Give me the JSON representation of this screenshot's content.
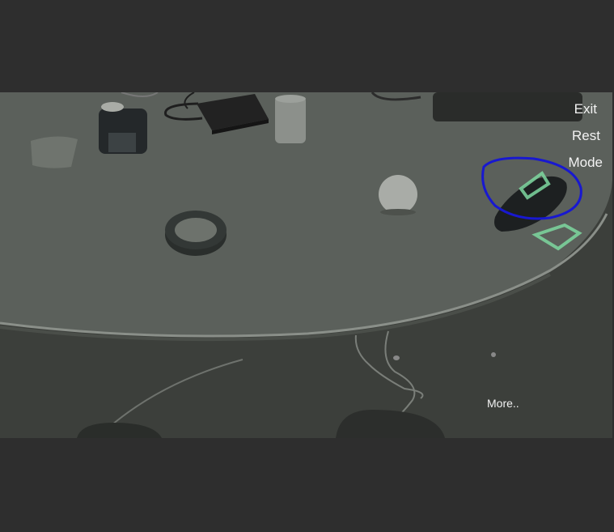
{
  "controls": {
    "exit_label": "Exit",
    "rest_label": "Rest",
    "mode_label": "Mode",
    "more_label": "More.."
  },
  "colors": {
    "background": "#2e2e2e",
    "annotation_stroke": "#1818d0",
    "detection_box": "#7ed8a0",
    "table_surface": "#5b605b",
    "floor": "#3c3f3b"
  },
  "icons": {
    "selection": "hand-drawn-circle",
    "detection": "bounding-box"
  }
}
